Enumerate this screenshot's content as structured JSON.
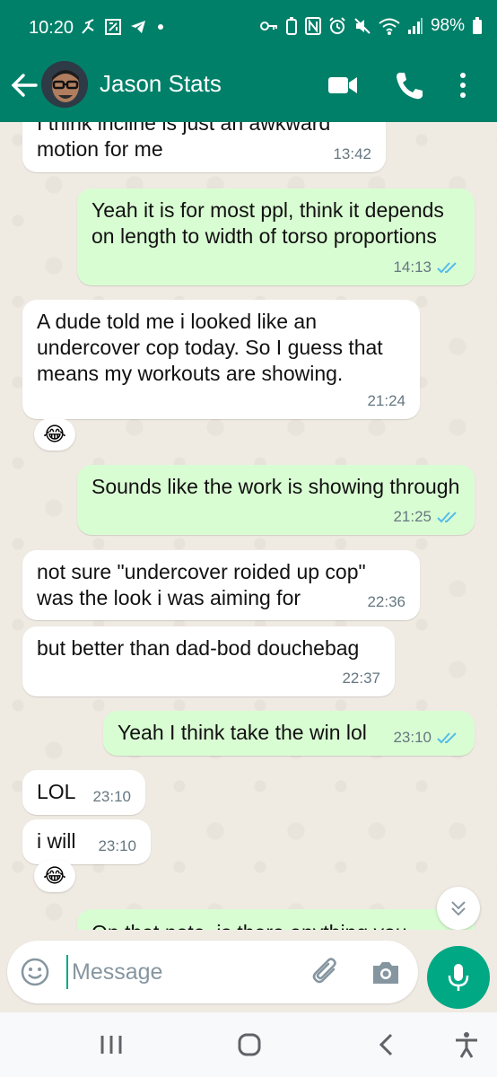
{
  "status_bar": {
    "time": "10:20",
    "battery": "98%",
    "icons_left": [
      "jumping-figure-icon",
      "transfer-icon",
      "telegram-icon",
      "dot-icon"
    ],
    "icons_right": [
      "key-icon",
      "battery-saver-icon",
      "nfc-icon",
      "alarm-icon",
      "mute-icon",
      "wifi-icon",
      "signal-icon",
      "battery-icon"
    ]
  },
  "header": {
    "contact_name": "Jason Stats",
    "accent_color": "#008069"
  },
  "messages": [
    {
      "dir": "in",
      "text": "I think incline is just an awkward motion for me",
      "time": "13:42"
    },
    {
      "dir": "out",
      "text": "Yeah it is for most ppl, think it depends on length to width of torso proportions",
      "time": "14:13",
      "read": true
    },
    {
      "dir": "in",
      "text": "A dude told me i looked like an undercover cop today. So I guess that means my workouts are showing.",
      "time": "21:24",
      "reaction": "😂"
    },
    {
      "dir": "out",
      "text": "Sounds like the work is showing through",
      "time": "21:25",
      "read": true
    },
    {
      "dir": "in",
      "text": "not sure \"undercover roided up cop\" was the look i was aiming for",
      "time": "22:36"
    },
    {
      "dir": "in",
      "text": "but better than dad-bod douchebag",
      "time": "22:37"
    },
    {
      "dir": "out",
      "text": "Yeah I think take the win lol",
      "time": "23:10",
      "read": true
    },
    {
      "dir": "in",
      "text": "LOL",
      "time": "23:10"
    },
    {
      "dir": "in",
      "text": "i will",
      "time": "23:10",
      "reaction": "😂"
    },
    {
      "dir": "out",
      "text": "On that note, is there anything you"
    }
  ],
  "composer": {
    "placeholder": "Message"
  },
  "colors": {
    "incoming_bubble": "#ffffff",
    "outgoing_bubble": "#d9fdd3",
    "read_ticks": "#53bdeb",
    "mic_button": "#00a884"
  }
}
